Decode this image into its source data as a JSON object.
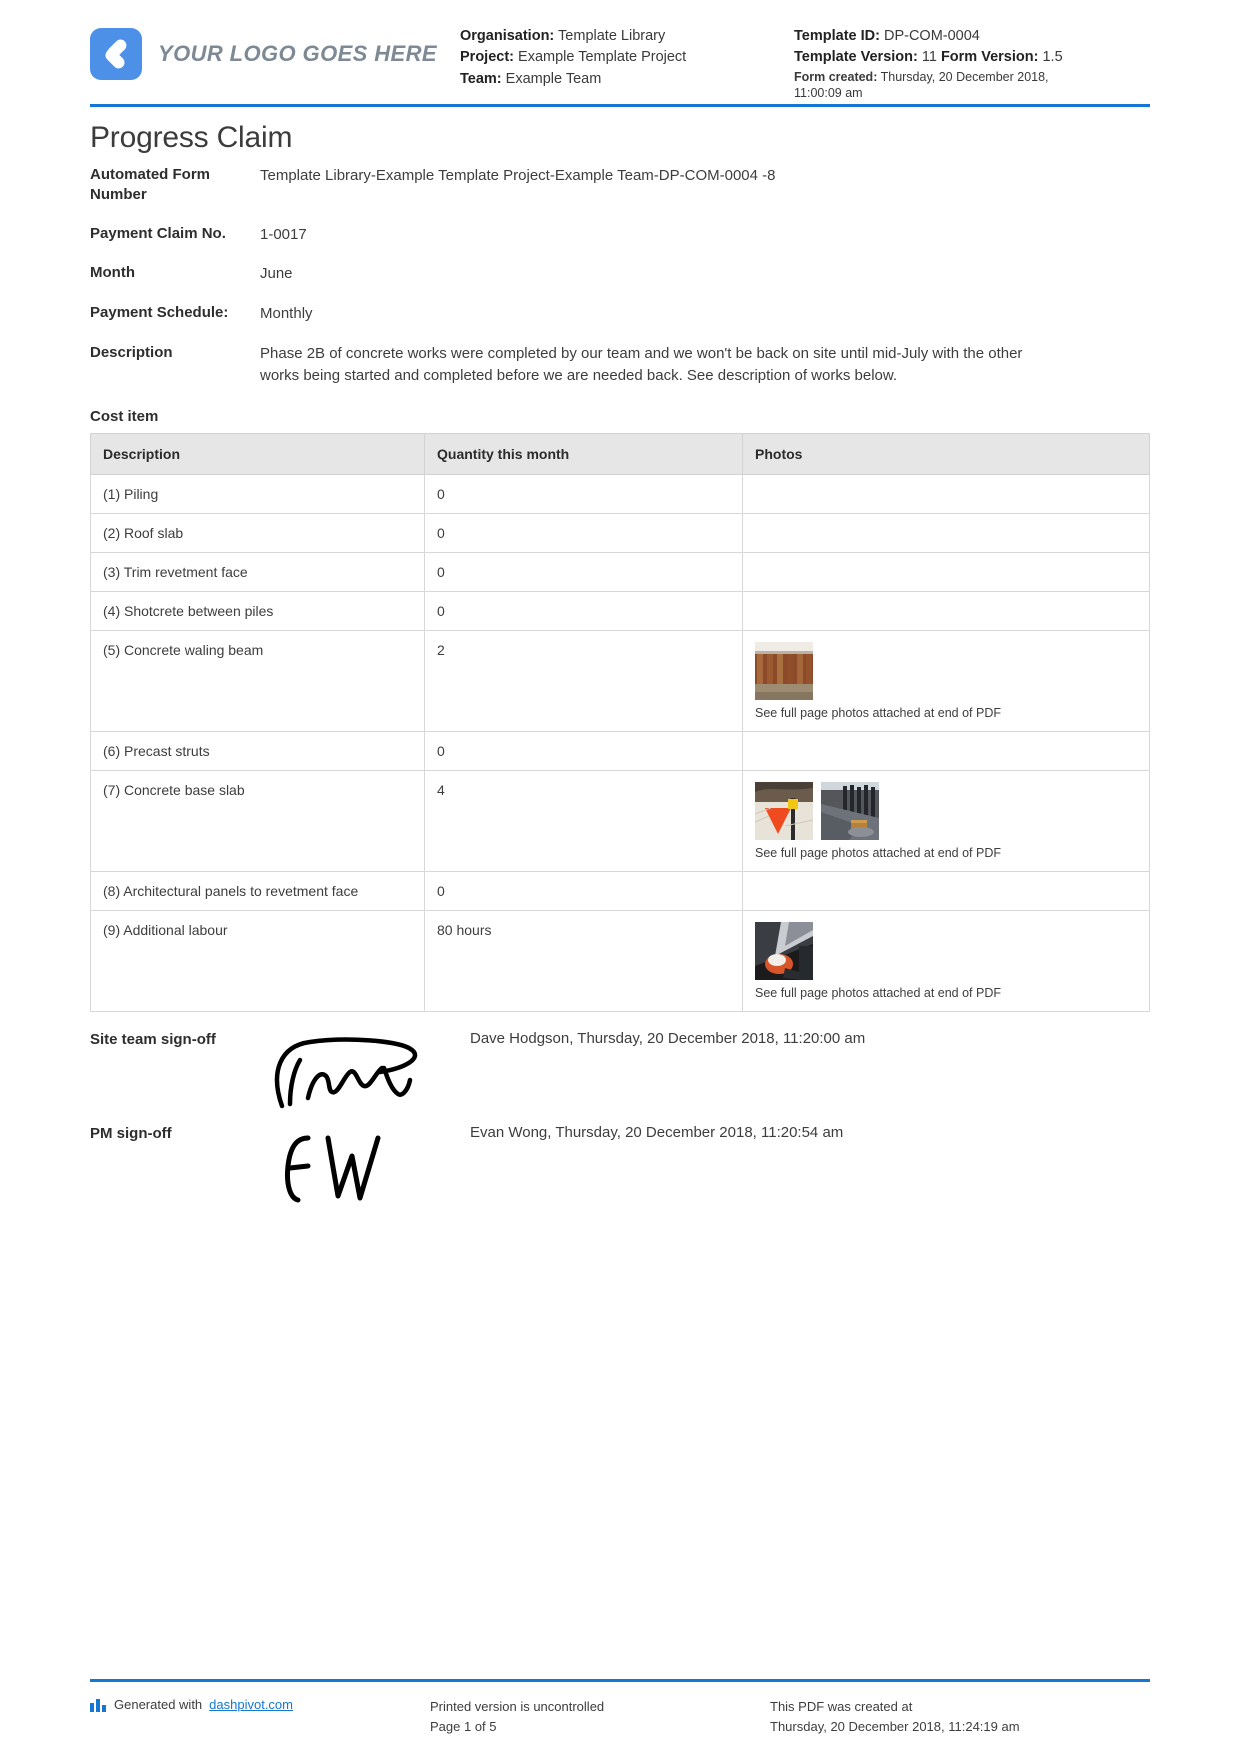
{
  "header": {
    "logo_text": "YOUR LOGO GOES HERE",
    "left_meta": {
      "organisation_label": "Organisation:",
      "organisation_value": "Template Library",
      "project_label": "Project:",
      "project_value": "Example Template Project",
      "team_label": "Team:",
      "team_value": "Example Team"
    },
    "right_meta": {
      "template_id_label": "Template ID:",
      "template_id_value": "DP-COM-0004",
      "template_version_label": "Template Version:",
      "template_version_value": "11",
      "form_version_label": "Form Version:",
      "form_version_value": "1.5",
      "form_created_label": "Form created:",
      "form_created_value": "Thursday, 20 December 2018,",
      "form_created_value_line2": "11:00:09 am"
    }
  },
  "title": "Progress Claim",
  "fields": [
    {
      "label": "Automated Form Number",
      "value": "Template Library-Example Template Project-Example Team-DP-COM-0004   -8"
    },
    {
      "label": "Payment Claim No.",
      "value": "1-0017"
    },
    {
      "label": "Month",
      "value": "June"
    },
    {
      "label": "Payment Schedule:",
      "value": "Monthly"
    },
    {
      "label": "Description",
      "value": "Phase 2B of concrete works were completed by our team and we won't be back on site until mid-July with the other works being started and completed before we are needed back. See description of works below."
    }
  ],
  "cost_item": {
    "section_label": "Cost item",
    "columns": [
      "Description",
      "Quantity this month",
      "Photos"
    ],
    "photo_note": "See full page photos attached at end of PDF",
    "rows": [
      {
        "description": "(1) Piling",
        "quantity": "0",
        "photos": 0
      },
      {
        "description": "(2) Roof slab",
        "quantity": "0",
        "photos": 0
      },
      {
        "description": "(3) Trim revetment face",
        "quantity": "0",
        "photos": 0
      },
      {
        "description": "(4) Shotcrete between piles",
        "quantity": "0",
        "photos": 0
      },
      {
        "description": "(5) Concrete waling beam",
        "quantity": "2",
        "photos": 1
      },
      {
        "description": "(6) Precast struts",
        "quantity": "0",
        "photos": 0
      },
      {
        "description": "(7) Concrete base slab",
        "quantity": "4",
        "photos": 2
      },
      {
        "description": "(8) Architectural panels to revetment face",
        "quantity": "0",
        "photos": 0
      },
      {
        "description": "(9) Additional labour",
        "quantity": "80 hours",
        "photos": 1
      }
    ]
  },
  "signoff": {
    "site_team_label": "Site team sign-off",
    "site_team_meta": "Dave Hodgson, Thursday, 20 December 2018, 11:20:00 am",
    "pm_label": "PM sign-off",
    "pm_meta": "Evan Wong, Thursday, 20 December 2018, 11:20:54 am"
  },
  "footer": {
    "generated_prefix": "Generated with ",
    "generated_link": "dashpivot.com",
    "uncontrolled": "Printed version is uncontrolled",
    "page": "Page 1 of 5",
    "created_line1": "This PDF was created at",
    "created_line2": "Thursday, 20 December 2018, 11:24:19 am"
  },
  "colors": {
    "accent": "#1577d4",
    "logo_blue": "#4d90e8",
    "table_header_bg": "#e6e6e6"
  }
}
